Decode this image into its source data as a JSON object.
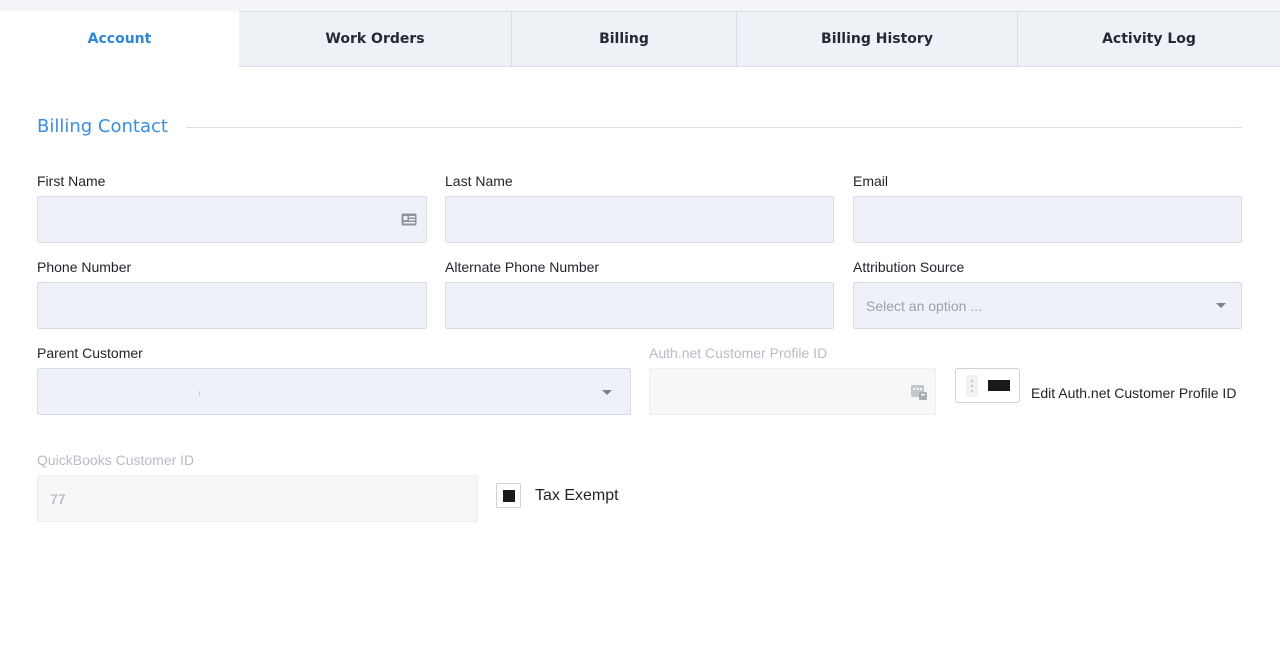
{
  "tabs": [
    {
      "label": "Account",
      "active": true
    },
    {
      "label": "Work Orders",
      "active": false
    },
    {
      "label": "Billing",
      "active": false
    },
    {
      "label": "Billing History",
      "active": false
    },
    {
      "label": "Activity Log",
      "active": false
    }
  ],
  "section": {
    "title": "Billing Contact"
  },
  "fields": {
    "first_name": {
      "label": "First Name",
      "value": "",
      "icon": "contact-card-icon"
    },
    "last_name": {
      "label": "Last Name",
      "value": ""
    },
    "email": {
      "label": "Email",
      "value": ""
    },
    "phone": {
      "label": "Phone Number",
      "value": ""
    },
    "alt_phone": {
      "label": "Alternate Phone Number",
      "value": ""
    },
    "attribution": {
      "label": "Attribution Source",
      "placeholder": "Select an option ..."
    },
    "parent_customer": {
      "label": "Parent Customer",
      "value": ""
    },
    "auth_net": {
      "label": "Auth.net Customer Profile ID",
      "value": "",
      "icon": "keypad-icon"
    },
    "quickbooks": {
      "label": "QuickBooks Customer ID",
      "value": "77"
    }
  },
  "toggle": {
    "label": "Edit Auth.net Customer Profile ID",
    "checked": false
  },
  "checkbox": {
    "label": "Tax Exempt",
    "checked": true
  },
  "colors": {
    "accent": "#3a8ee0",
    "input_bg": "#eef1f8"
  }
}
